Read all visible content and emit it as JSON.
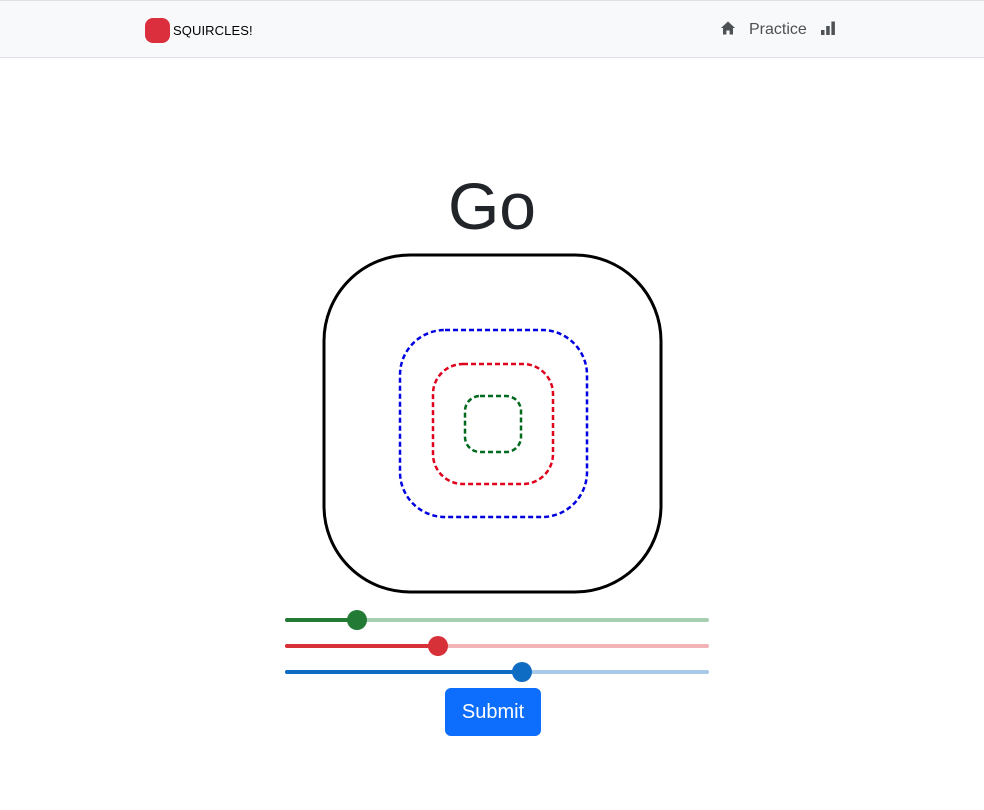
{
  "navbar": {
    "brand": "SQUIRCLES!",
    "brand_logo_color": "#dc2f3e",
    "home_icon": "home-icon",
    "practice_label": "Practice",
    "stats_icon": "bar-chart-icon"
  },
  "main": {
    "title": "Go",
    "submit_label": "Submit"
  },
  "colors": {
    "outer": "#000000",
    "blue": "#0000e0",
    "red": "#e0001c",
    "green": "#006a1c",
    "submit": "#0d6efd"
  },
  "sliders": [
    {
      "name": "green-slider",
      "color": "#237a35",
      "track": "#a9cfb2",
      "value": 0.17
    },
    {
      "name": "red-slider",
      "color": "#d63038",
      "track": "#f2b3b6",
      "value": 0.36
    },
    {
      "name": "blue-slider",
      "color": "#0f6cc3",
      "track": "#a9c9e8",
      "value": 0.56
    }
  ]
}
